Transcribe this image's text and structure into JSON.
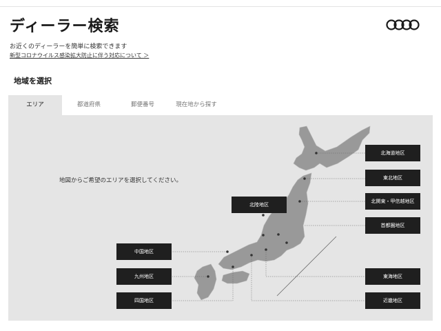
{
  "header": {
    "title": "ディーラー検索",
    "description": "お近くのディーラーを簡単に検索できます",
    "notice_link": "新型コロナウイルス感染拡大防止に伴う対応について ＞"
  },
  "section": {
    "title": "地域を選択"
  },
  "tabs": [
    {
      "label": "エリア",
      "active": true
    },
    {
      "label": "都道府県",
      "active": false
    },
    {
      "label": "郵便番号",
      "active": false
    },
    {
      "label": "現在地から探す",
      "active": false
    }
  ],
  "map": {
    "lead": "地図からご希望のエリアを選択してください。",
    "regions": {
      "hokkaido": "北海道地区",
      "tohoku": "東北地区",
      "hokuriku": "北陸地区",
      "kitakanto": "北関東・甲信越地区",
      "shutoken": "首都圏地区",
      "chugoku": "中国地区",
      "kyushu": "九州地区",
      "shikoku": "四国地区",
      "tokai": "東海地区",
      "kinki": "近畿地区"
    }
  },
  "colors": {
    "region_button": "#1f1f1f",
    "panel": "#e5e5e5",
    "map_land": "#999999"
  }
}
